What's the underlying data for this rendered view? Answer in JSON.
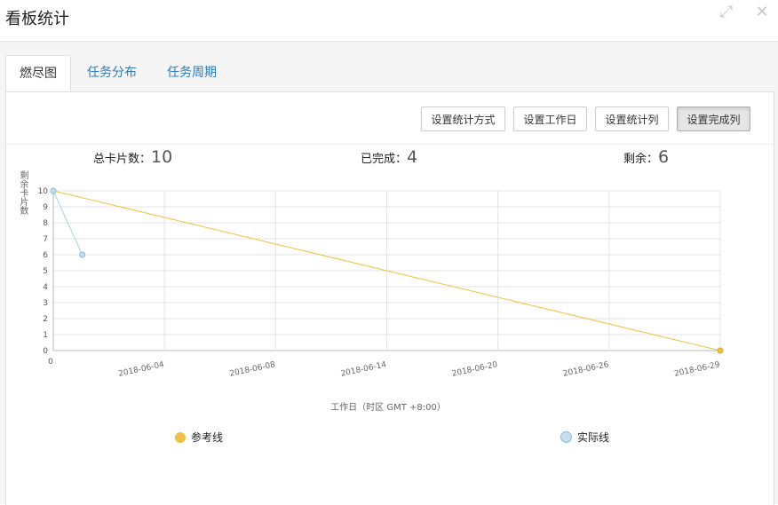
{
  "window": {
    "title": "看板统计",
    "expand_icon": "expand-arrows-icon",
    "close_icon": "close-icon"
  },
  "tabs": [
    {
      "label": "燃尽图",
      "active": true
    },
    {
      "label": "任务分布",
      "active": false
    },
    {
      "label": "任务周期",
      "active": false
    }
  ],
  "toolbar": {
    "stat_method": "设置统计方式",
    "workday": "设置工作日",
    "stat_column": "设置统计列",
    "done_column": "设置完成列"
  },
  "stats": {
    "total_label": "总卡片数：",
    "total_value": "10",
    "done_label": "已完成：",
    "done_value": "4",
    "remaining_label": "剩余：",
    "remaining_value": "6"
  },
  "chart_data": {
    "type": "line",
    "ylabel": "剩余卡片数",
    "xlabel": "工作日（时区 GMT +8:00）",
    "ylim": [
      0,
      10
    ],
    "yticks": [
      "0",
      "1",
      "2",
      "3",
      "4",
      "5",
      "6",
      "7",
      "8",
      "9",
      "10"
    ],
    "xtick_labels": [
      "0",
      "2018-06-04",
      "2018-06-08",
      "2018-06-14",
      "2018-06-20",
      "2018-06-26",
      "2018-06-29"
    ],
    "x_count": 24,
    "grid": true,
    "series": [
      {
        "name": "参考线",
        "color": "#f0c040",
        "points": [
          [
            0,
            10
          ],
          [
            23,
            0
          ]
        ]
      },
      {
        "name": "实际线",
        "color": "#a8d4ec",
        "points": [
          [
            0,
            10
          ],
          [
            1,
            6
          ]
        ]
      }
    ],
    "legend": [
      "参考线",
      "实际线"
    ]
  }
}
